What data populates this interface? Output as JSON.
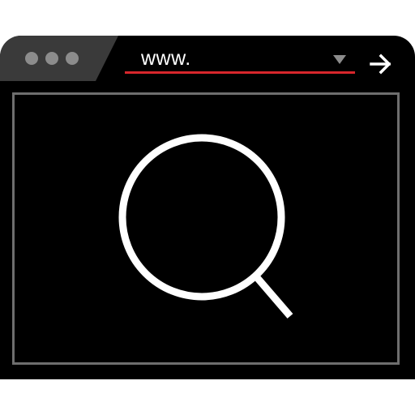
{
  "browser": {
    "title_dots": [
      "window-dot",
      "window-dot",
      "window-dot"
    ],
    "address_bar": {
      "value": "www.",
      "underline_color": "#d7262c",
      "dropdown_icon": "triangle-down-icon"
    },
    "go_button": {
      "icon": "arrow-right-icon"
    }
  },
  "content": {
    "center_icon": "magnifying-glass-icon"
  },
  "colors": {
    "window_background": "#000000",
    "tab_background": "#3a3a3a",
    "dot_color": "#8c8c8c",
    "frame_border": "#6e6e6e",
    "accent": "#d7262c",
    "icon_color": "#ffffff"
  }
}
